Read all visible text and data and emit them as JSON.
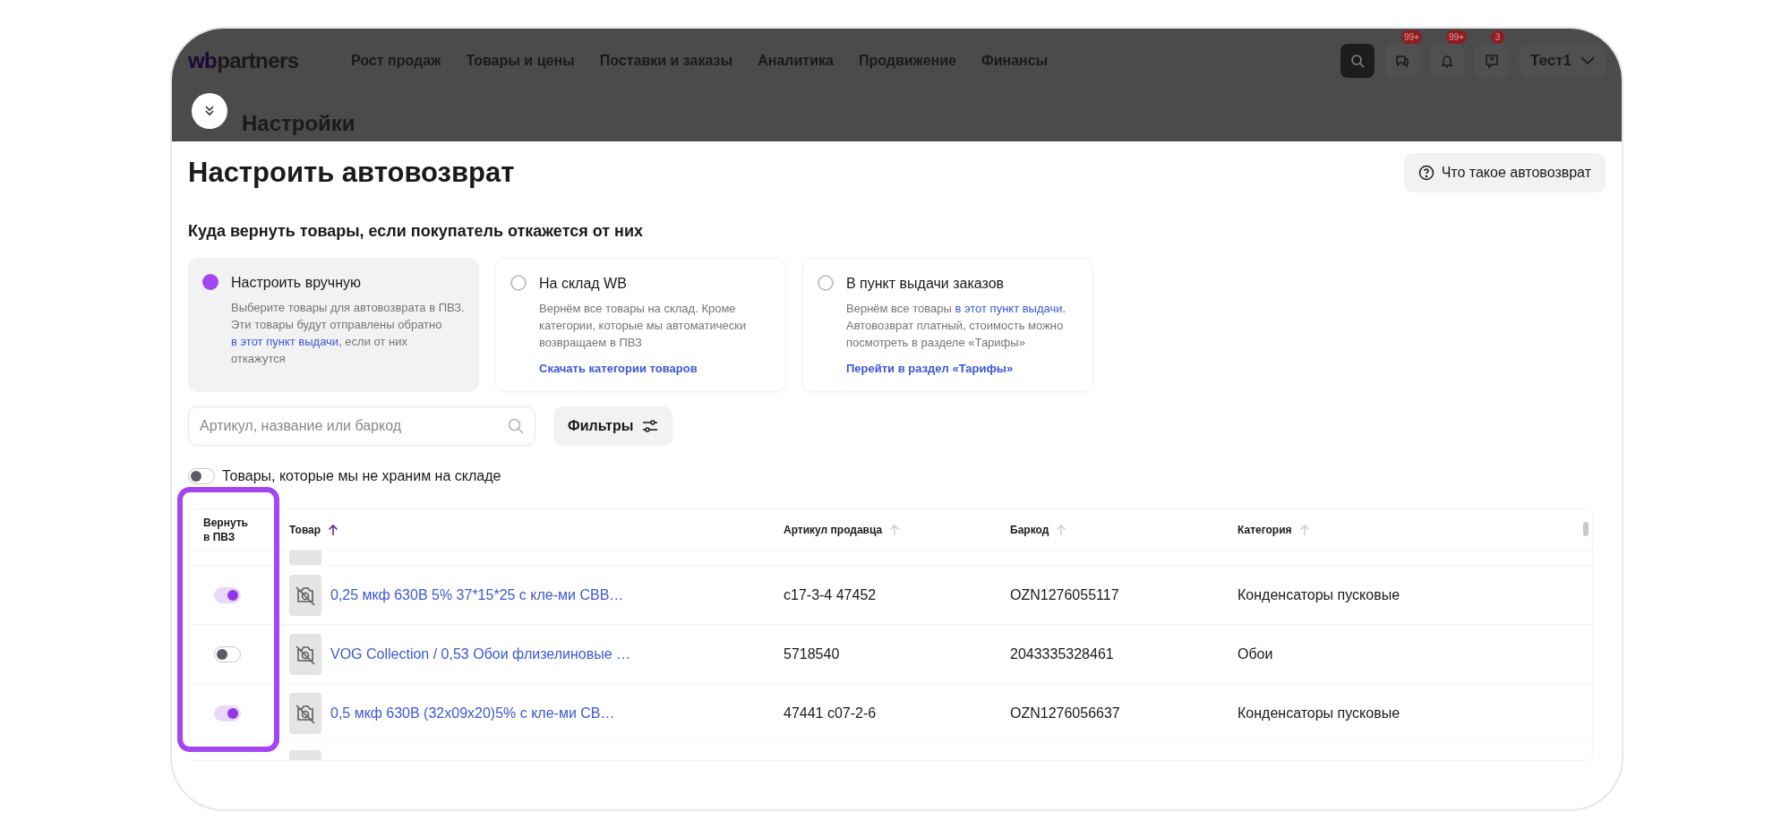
{
  "header": {
    "logo": {
      "mark": "wb",
      "text": "partners"
    },
    "nav": [
      "Рост продаж",
      "Товары и цены",
      "Поставки и заказы",
      "Аналитика",
      "Продвижение",
      "Финансы"
    ],
    "icon_buttons": [
      {
        "kind": "search"
      },
      {
        "kind": "chat",
        "badge": "99+"
      },
      {
        "kind": "bell",
        "badge": "99+"
      },
      {
        "kind": "help",
        "badge": "3"
      }
    ],
    "user": "Тест1",
    "section": "Настройки"
  },
  "title": "Настроить автовозврат",
  "help_button": "Что такое автовозврат",
  "question": "Куда вернуть товары, если покупатель откажется от них",
  "options": [
    {
      "title": "Настроить вручную",
      "selected": true,
      "description": [
        {
          "kind": "text",
          "text": "Выберите товары для автовозврата в ПВЗ. Эти товары будут отправлены обратно "
        },
        {
          "kind": "link",
          "text": "в этот пункт выдачи"
        },
        {
          "kind": "text",
          "text": ", если от них откажутся"
        }
      ]
    },
    {
      "title": "На склад WB",
      "selected": false,
      "description": [
        {
          "kind": "text",
          "text": "Вернём все товары на склад. Кроме категории, которые мы автоматически возвращаем в ПВЗ"
        }
      ],
      "action": "Скачать категории товаров"
    },
    {
      "title": "В пункт выдачи заказов",
      "selected": false,
      "description": [
        {
          "kind": "text",
          "text": "Вернём все товары "
        },
        {
          "kind": "link",
          "text": "в этот пункт выдачи."
        },
        {
          "kind": "text",
          "text": " Автовозврат платный, стоимость можно посмотреть в разделе «Тарифы»"
        }
      ],
      "action": "Перейти в раздел «Тарифы»"
    }
  ],
  "search": {
    "placeholder": "Артикул, название или баркод"
  },
  "filters_button": "Фильтры",
  "stock_toggle": {
    "label": "Товары, которые мы не храним на складе",
    "on": false
  },
  "table": {
    "columns": [
      {
        "label": "Вернуть в ПВЗ"
      },
      {
        "label": "Товар",
        "sorted": true
      },
      {
        "label": "Артикул продавца",
        "sorted": false
      },
      {
        "label": "Баркод",
        "sorted": false
      },
      {
        "label": "Категория",
        "sorted": false
      }
    ],
    "rows": [
      {
        "return": true,
        "product": "0,25 мкф 630В 5% 37*15*25 с кле-ми СВВ…",
        "article": "c17-3-4 47452",
        "barcode": "OZN1276055117",
        "category": "Конденсаторы пусковые"
      },
      {
        "return": false,
        "product": "VOG Collection / 0,53 Обои флизелиновые …",
        "article": "5718540",
        "barcode": "2043335328461",
        "category": "Обои"
      },
      {
        "return": true,
        "product": "0,5 мкф 630В (32x09x20)5% с кле-ми СВ…",
        "article": "47441 c07-2-6",
        "barcode": "OZN1276056637",
        "category": "Конденсаторы пусковые"
      }
    ]
  }
}
